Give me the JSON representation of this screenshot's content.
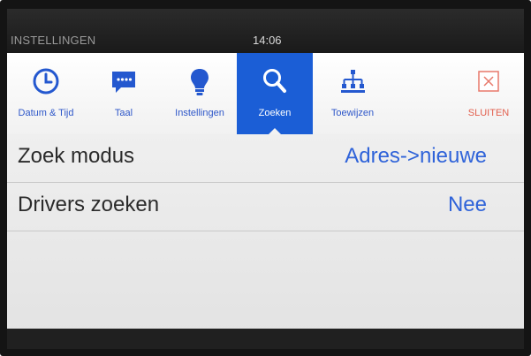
{
  "status": {
    "title": "INSTELLINGEN",
    "time": "14:06"
  },
  "tabs": [
    {
      "label": "Datum & Tijd",
      "icon": "clock-icon"
    },
    {
      "label": "Taal",
      "icon": "speech-bubble-icon"
    },
    {
      "label": "Instellingen",
      "icon": "lightbulb-icon"
    },
    {
      "label": "Zoeken",
      "icon": "search-icon",
      "active": true
    },
    {
      "label": "Toewijzen",
      "icon": "hierarchy-icon"
    },
    {
      "label": "SLUITEN",
      "icon": "close-icon"
    }
  ],
  "settings": [
    {
      "name": "Zoek modus",
      "value": "Adres->nieuwe"
    },
    {
      "name": "Drivers zoeken",
      "value": "Nee"
    }
  ],
  "colors": {
    "accent": "#1b5ed6",
    "label": "#2e57c9",
    "value": "#2f63d9",
    "close": "#e25f4d"
  }
}
